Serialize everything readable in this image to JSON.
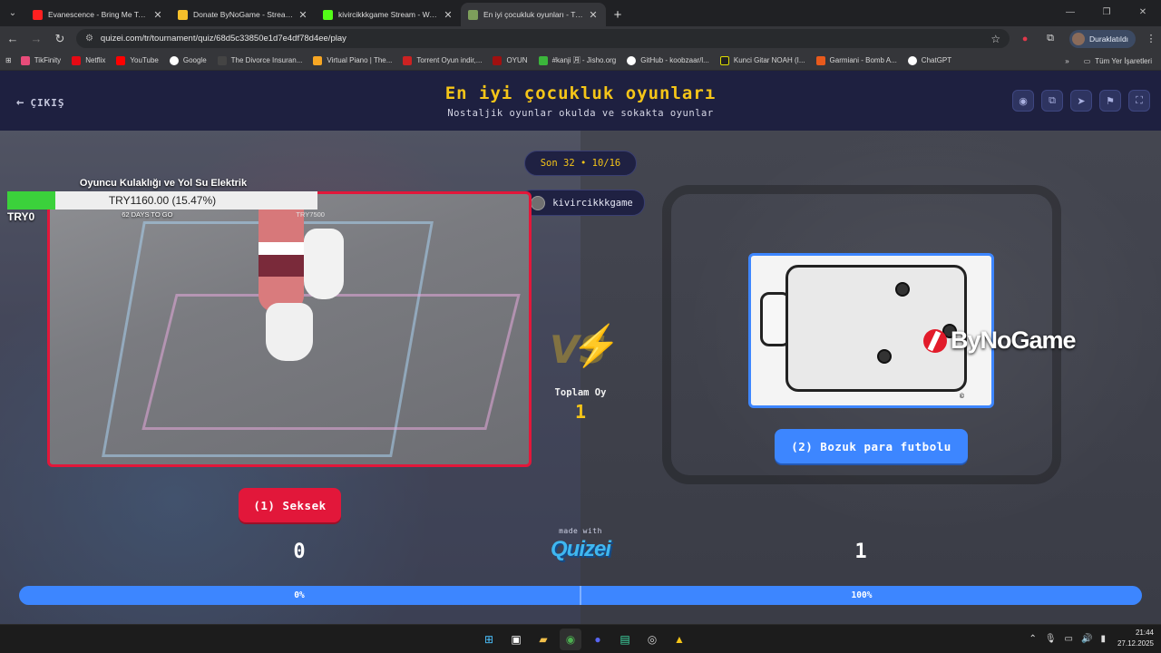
{
  "browser": {
    "tabs": [
      {
        "title": "Evanescence - Bring Me To Life",
        "favicon_color": "#ff2020",
        "active": false
      },
      {
        "title": "Donate ByNoGame - Streamer",
        "favicon_color": "#f6c02b",
        "active": false
      },
      {
        "title": "kivircikkkgame Stream - Watch",
        "favicon_color": "#53fc18",
        "active": false
      },
      {
        "title": "En iyi çocukluk oyunları - Tier Li",
        "favicon_color": "#7d9e5b",
        "active": true
      }
    ],
    "url": "quizei.com/tr/tournament/quiz/68d5c33850e1d7e4df78d4ee/play",
    "profile_label": "Duraklatıldı",
    "bookmarks": [
      {
        "label": "TikFinity",
        "color": "#e84c7a"
      },
      {
        "label": "Netflix",
        "color": "#e50914"
      },
      {
        "label": "YouTube",
        "color": "#ff0000"
      },
      {
        "label": "Google",
        "color": "#ffffff"
      },
      {
        "label": "The Divorce Insuran...",
        "color": "#222222"
      },
      {
        "label": "Virtual Piano | The...",
        "color": "#f7a623"
      },
      {
        "label": "Torrent Oyun indir,...",
        "color": "#cc2222"
      },
      {
        "label": "OYUN",
        "color": "#a01010"
      },
      {
        "label": "#kanji 🈷 - Jisho.org",
        "color": "#3bb53b"
      },
      {
        "label": "GitHub - koobzaar/l...",
        "color": "#ffffff"
      },
      {
        "label": "Kunci Gitar NOAH (I...",
        "color": "#222222"
      },
      {
        "label": "Garmiani - Bomb A...",
        "color": "#e85a1c"
      },
      {
        "label": "ChatGPT",
        "color": "#ffffff"
      }
    ],
    "bookmarks_other": "Tüm Yer İşaretleri"
  },
  "quiz": {
    "exit_label": "ÇIKIŞ",
    "title": "En iyi çocukluk oyunları",
    "subtitle": "Nostaljik oyunlar okulda ve sokakta oyunlar",
    "round_label": "Son 32 • 10/16",
    "username": "kivircikkkgame",
    "total_label": "Toplam Oy",
    "total_value": "1",
    "left": {
      "button": "(1) Seksek",
      "score": "0",
      "percent": "0%"
    },
    "right": {
      "button": "(2) Bozuk para futbolu",
      "score": "1",
      "percent": "100%"
    },
    "made_with": "made with",
    "brand": "Quizei",
    "progress_left_fraction": 0.0,
    "colors": {
      "accent": "#f5c518",
      "left": "#e2173a",
      "right": "#3d86ff"
    }
  },
  "donation": {
    "title": "Oyuncu Kulaklığı ve Yol Su Elektrik",
    "amount": "TRY1160.00 (15.47%)",
    "progress_fraction": 0.1547,
    "min": "TRY0",
    "days": "62 DAYS TO GO",
    "max": "TRY7500"
  },
  "sponsor": {
    "text": "ByNoGame"
  },
  "taskbar": {
    "time": "21:44",
    "date": "27.12.2025"
  }
}
